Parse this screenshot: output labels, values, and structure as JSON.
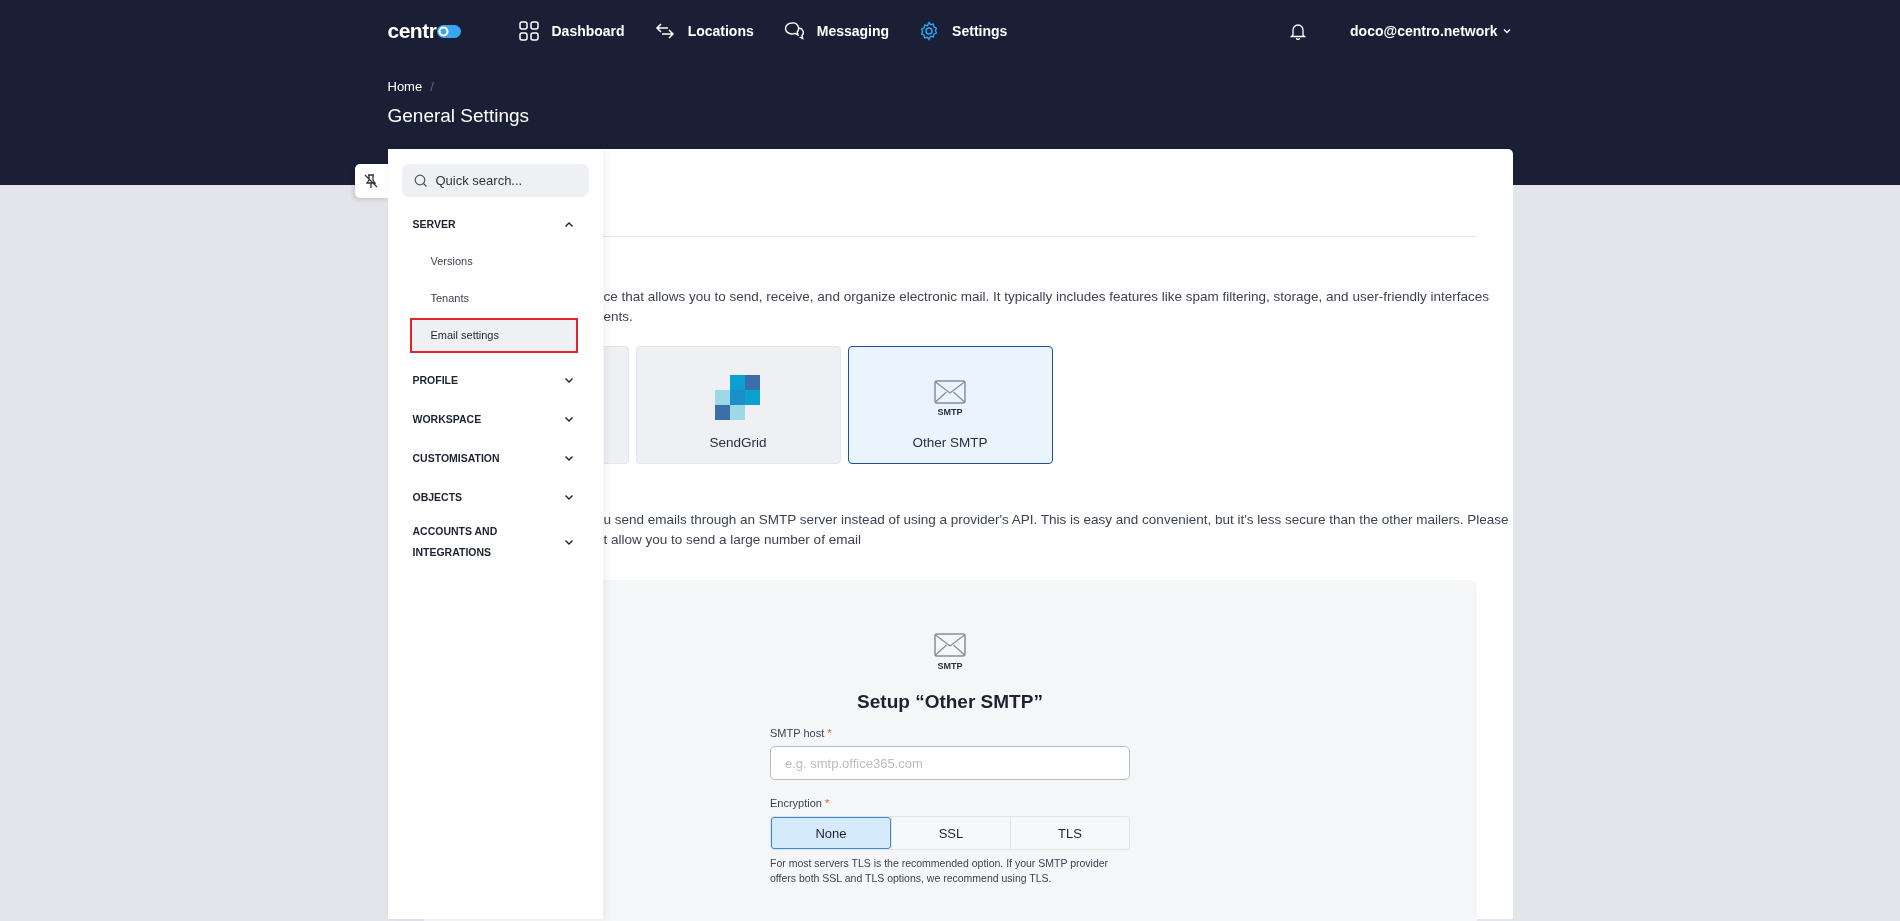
{
  "nav": {
    "logo": "centr",
    "items": [
      {
        "label": "Dashboard",
        "selected": false
      },
      {
        "label": "Locations",
        "selected": false
      },
      {
        "label": "Messaging",
        "selected": false
      },
      {
        "label": "Settings",
        "selected": true
      }
    ],
    "user": "doco@centro.network"
  },
  "breadcrumb": {
    "items": [
      "Home"
    ],
    "separator": "/"
  },
  "page_title": "General Settings",
  "sidebar": {
    "search_placeholder": "Quick search...",
    "sections": [
      {
        "label": "SERVER",
        "expanded": true,
        "children": [
          {
            "label": "Versions",
            "selected": false
          },
          {
            "label": "Tenants",
            "selected": false
          },
          {
            "label": "Email settings",
            "selected": true
          }
        ]
      },
      {
        "label": "PROFILE",
        "expanded": false
      },
      {
        "label": "WORKSPACE",
        "expanded": false
      },
      {
        "label": "CUSTOMISATION",
        "expanded": false
      },
      {
        "label": "OBJECTS",
        "expanded": false
      },
      {
        "label": "ACCOUNTS AND INTEGRATIONS",
        "expanded": false
      }
    ]
  },
  "intro_lines": [
    "ce that allows you to send, receive, and organize electronic mail. It typically includes features like spam filtering, storage, and user-friendly interfaces",
    "ents."
  ],
  "providers": [
    {
      "kind": "partial",
      "selected": false
    },
    {
      "kind": "sendgrid",
      "label": "SendGrid",
      "selected": false
    },
    {
      "kind": "smtp",
      "label": "Other SMTP",
      "icon_label": "SMTP",
      "selected": true
    }
  ],
  "note_lines": [
    "u send emails through an SMTP server instead of using a provider's API. This is easy and convenient, but it's less secure than the other mailers. Please",
    "t allow you to send a large number of email"
  ],
  "setup": {
    "icon_label": "SMTP",
    "title": "Setup “Other SMTP”",
    "host": {
      "label": "SMTP host",
      "required_mark": "*",
      "placeholder": "e.g. smtp.office365.com"
    },
    "encryption": {
      "label": "Encryption",
      "required_mark": "*",
      "options": [
        {
          "label": "None",
          "selected": true
        },
        {
          "label": "SSL",
          "selected": false
        },
        {
          "label": "TLS",
          "selected": false
        }
      ]
    },
    "help": "For most servers TLS is the recommended option. If your SMTP provider offers both SSL and TLS options, we recommend using TLS."
  }
}
